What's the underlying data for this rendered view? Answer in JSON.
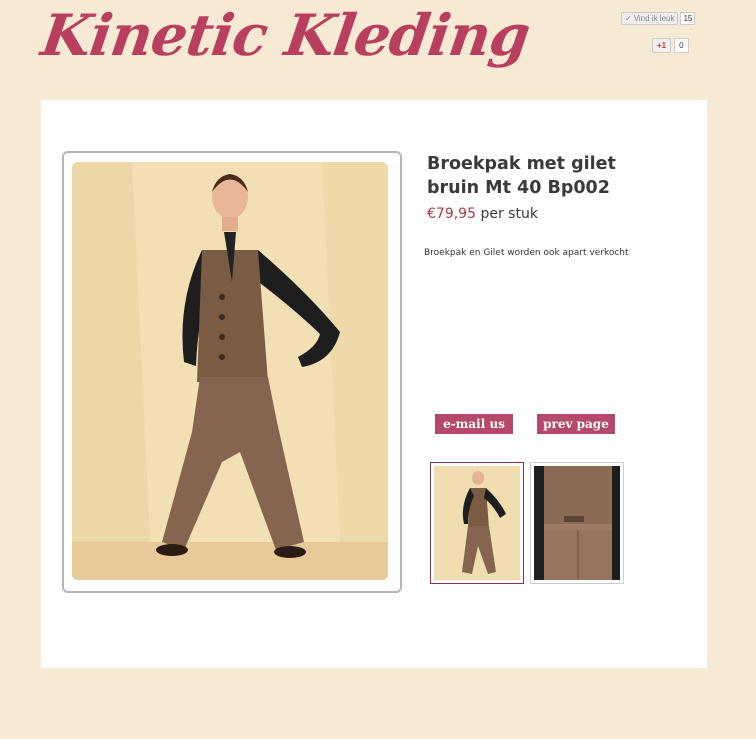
{
  "header": {
    "logo_text": "Kinetic Kleding",
    "fb_like_label": "Vind ik leuk",
    "fb_like_count": "15",
    "gplus_label": "+1",
    "gplus_count": "0"
  },
  "product": {
    "title": "Broekpak met gilet bruin Mt 40 Bp002",
    "price": "€79,95",
    "unit": "per stuk",
    "description": "Broekpak en Gilet worden ook apart verkocht"
  },
  "buttons": {
    "email": "e-mail us",
    "prev": "prev page"
  },
  "colors": {
    "page_bg": "#f7ead5",
    "accent": "#b8405e",
    "button": "#b5496a"
  }
}
